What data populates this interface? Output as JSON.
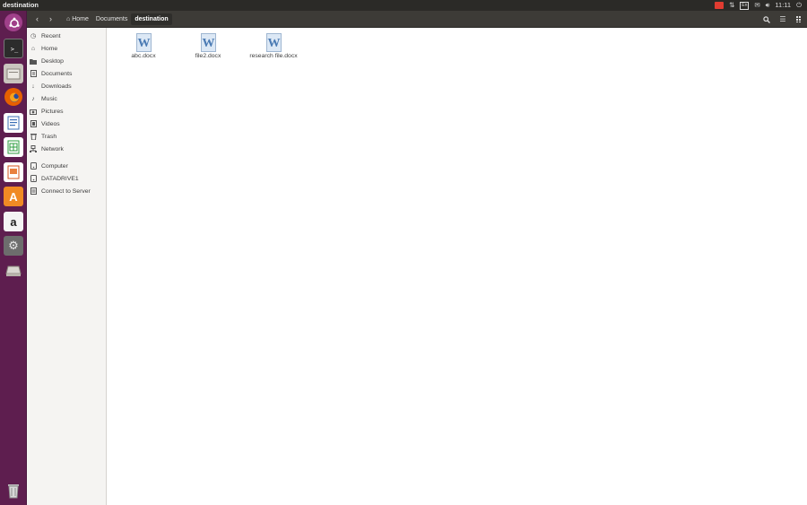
{
  "window_title": "destination",
  "panel": {
    "clock": "11:11",
    "keyboard_layout": "En"
  },
  "breadcrumbs": [
    {
      "label": "Home"
    },
    {
      "label": "Documents"
    },
    {
      "label": "destination"
    }
  ],
  "sidebar": {
    "items": [
      {
        "label": "Recent",
        "icon": "clock-icon"
      },
      {
        "label": "Home",
        "icon": "home-icon"
      },
      {
        "label": "Desktop",
        "icon": "folder-icon"
      },
      {
        "label": "Documents",
        "icon": "documents-icon"
      },
      {
        "label": "Downloads",
        "icon": "download-icon"
      },
      {
        "label": "Music",
        "icon": "music-icon"
      },
      {
        "label": "Pictures",
        "icon": "camera-icon"
      },
      {
        "label": "Videos",
        "icon": "film-icon"
      },
      {
        "label": "Trash",
        "icon": "trash-icon"
      },
      {
        "label": "Network",
        "icon": "network-icon"
      },
      {
        "label": "Computer",
        "icon": "drive-icon"
      },
      {
        "label": "DATADRIVE1",
        "icon": "drive-icon"
      },
      {
        "label": "Connect to Server",
        "icon": "server-icon"
      }
    ]
  },
  "files": [
    {
      "name": "abc.docx",
      "icon": "word-document-icon"
    },
    {
      "name": "file2.docx",
      "icon": "word-document-icon"
    },
    {
      "name": "research file.docx",
      "icon": "word-document-icon"
    }
  ],
  "launcher": [
    "ubuntu-dash-icon",
    "terminal-icon",
    "files-icon",
    "firefox-icon",
    "writer-icon",
    "calc-icon",
    "impress-icon",
    "software-center-icon",
    "amazon-icon",
    "settings-icon",
    "removable-drive-icon",
    "trash-icon"
  ],
  "colors": {
    "launcher_bg": "#5e1e4f",
    "panel_bg": "#2b2a27",
    "headerbar_bg": "#3d3b37",
    "sidebar_bg": "#f5f4f2",
    "word_blue": "#4a7ab3"
  }
}
